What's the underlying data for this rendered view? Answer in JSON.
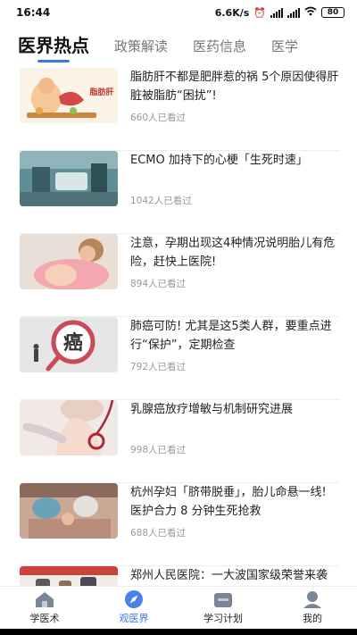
{
  "status": {
    "time": "16:44",
    "speed": "6.6K/s",
    "battery": "80"
  },
  "tabs": [
    "医界热点",
    "政策解读",
    "医药信息",
    "医学"
  ],
  "articles": [
    {
      "title": "脂肪肝不都是肥胖惹的祸 5个原因使得肝脏被脂肪“困扰”!",
      "views": "660人已看过",
      "thumb_text": "脂肪肝"
    },
    {
      "title": "ECMO 加持下的心梗「生死时速」",
      "views": "1042人已看过"
    },
    {
      "title": "注意，孕期出现这4种情况说明胎儿有危险，赶快上医院!",
      "views": "894人已看过"
    },
    {
      "title": "肺癌可防! 尤其是这5类人群，要重点进行“保护”，定期检查",
      "views": "792人已看过",
      "thumb_text": "癌"
    },
    {
      "title": "乳腺癌放疗增敏与机制研究进展",
      "views": "998人已看过"
    },
    {
      "title": "杭州孕妇「脐带脱垂」，胎儿命悬一线! 医护合力 8 分钟生死抢救",
      "views": "688人已看过"
    },
    {
      "title": "郑州人民医院：一大波国家级荣誉来袭",
      "views": ""
    }
  ],
  "nav": [
    {
      "label": "学医术",
      "icon": "home-icon"
    },
    {
      "label": "观医界",
      "icon": "compass-icon"
    },
    {
      "label": "学习计划",
      "icon": "folder-icon"
    },
    {
      "label": "我的",
      "icon": "user-icon"
    }
  ],
  "colors": {
    "accent": "#3a79e8",
    "active_nav_icon": "#4a82e8",
    "inactive_nav_icon": "#7a8595"
  }
}
